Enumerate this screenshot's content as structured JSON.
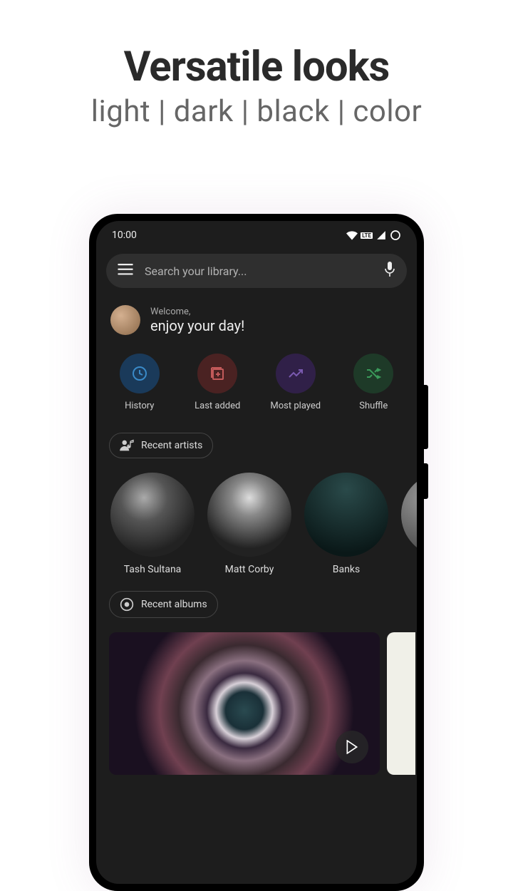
{
  "promo": {
    "title": "Versatile looks",
    "subtitle": "light | dark | black | color"
  },
  "statusbar": {
    "time": "10:00",
    "lte": "LTE"
  },
  "search": {
    "placeholder": "Search your library..."
  },
  "welcome": {
    "sub": "Welcome,",
    "main": "enjoy your day!"
  },
  "quick": {
    "history": "History",
    "last_added": "Last added",
    "most_played": "Most played",
    "shuffle": "Shuffle"
  },
  "sections": {
    "recent_artists": "Recent artists",
    "recent_albums": "Recent albums"
  },
  "artists": [
    {
      "name": "Tash Sultana"
    },
    {
      "name": "Matt Corby"
    },
    {
      "name": "Banks"
    }
  ]
}
